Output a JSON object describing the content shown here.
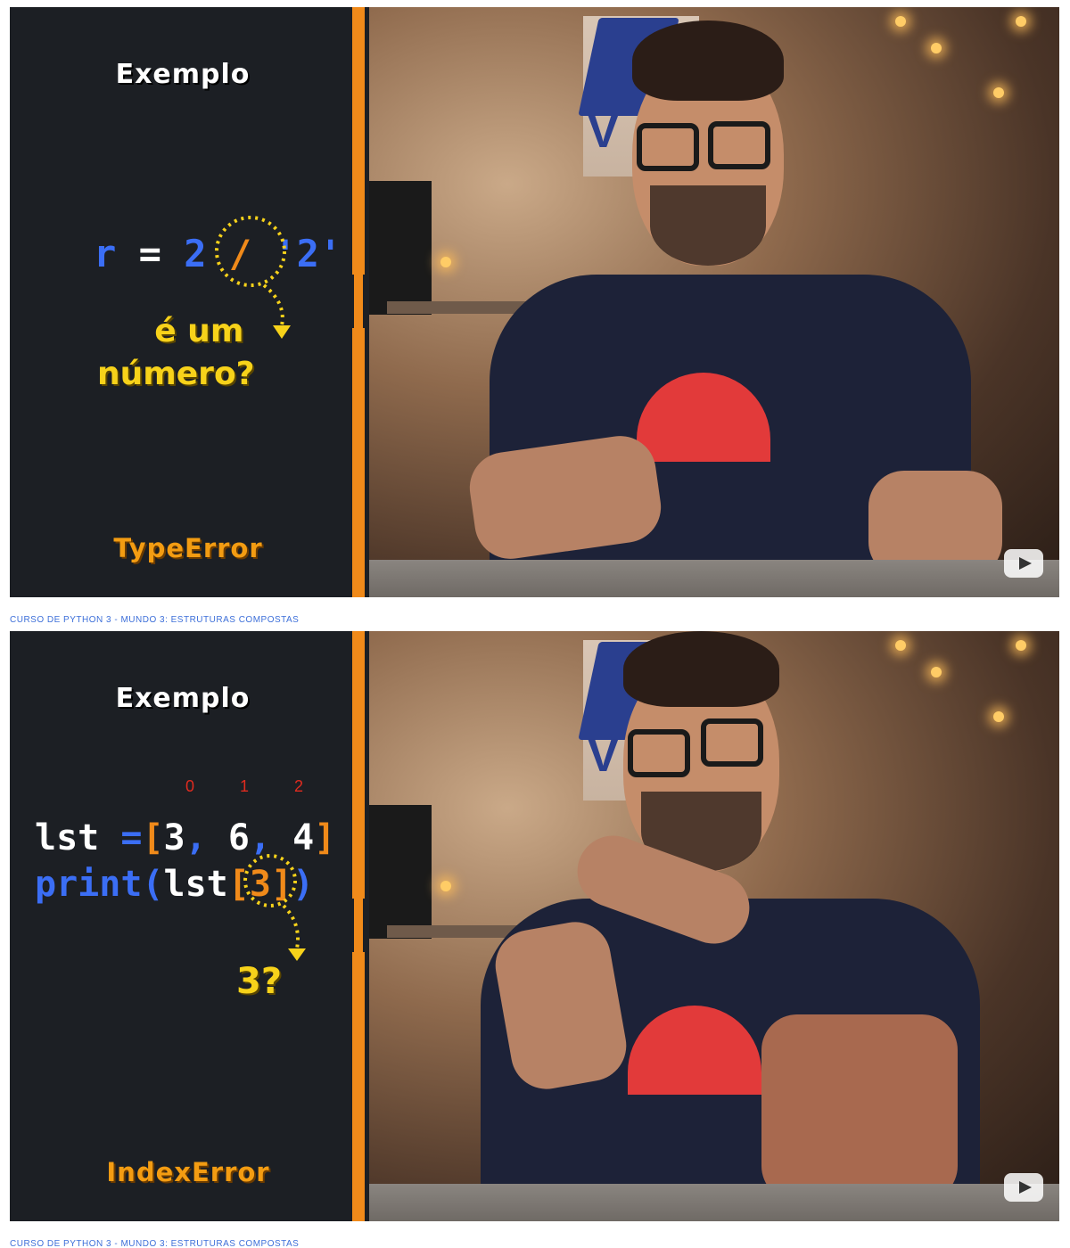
{
  "frames": [
    {
      "title": "Exemplo",
      "code": {
        "var": "r",
        "eq": "=",
        "num": "2",
        "op": "/",
        "str": "'2'"
      },
      "question_line1": "é um",
      "question_line2": "número?",
      "error": "TypeError",
      "caption": "CURSO DE PYTHON 3 - MUNDO 3: ESTRUTURAS COMPOSTAS",
      "play_icon": "play-icon"
    },
    {
      "title": "Exemplo",
      "indices": [
        "0",
        "1",
        "2"
      ],
      "code_line1": {
        "name": "lst",
        "eq": "=",
        "open": "[",
        "v0": "3",
        "c1": ",",
        "v1": "6",
        "c2": ",",
        "v2": "4",
        "close": "]"
      },
      "code_line2": {
        "fn": "print(",
        "name": "lst",
        "open": "[",
        "idx": "3",
        "close": "]",
        "paren": ")"
      },
      "question": "3?",
      "error": "IndexError",
      "caption": "CURSO DE PYTHON 3 - MUNDO 3: ESTRUTURAS COMPOSTAS",
      "play_icon": "play-icon"
    }
  ],
  "colors": {
    "panel": "#1c1f24",
    "orange": "#f08a1a",
    "yellow": "#f7d21a",
    "blue": "#3b6ef5",
    "red": "#e02b1f",
    "caption": "#3d6fd9"
  }
}
